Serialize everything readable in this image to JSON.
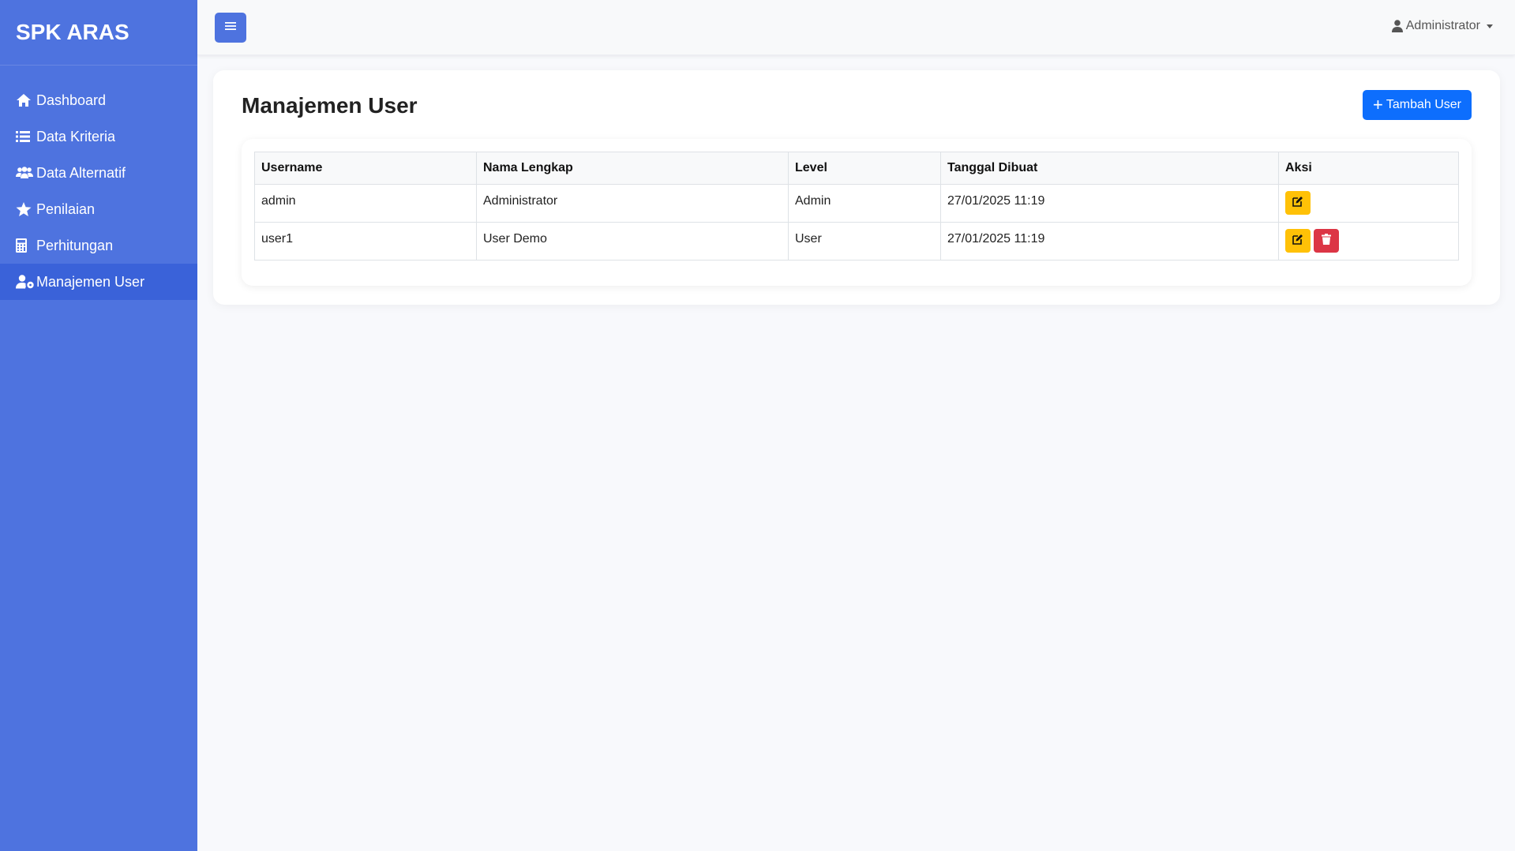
{
  "app": {
    "brand": "SPK ARAS"
  },
  "sidebar": {
    "items": [
      {
        "label": "Dashboard",
        "icon": "home-icon",
        "active": false
      },
      {
        "label": "Data Kriteria",
        "icon": "list-icon",
        "active": false
      },
      {
        "label": "Data Alternatif",
        "icon": "users-icon",
        "active": false
      },
      {
        "label": "Penilaian",
        "icon": "star-icon",
        "active": false
      },
      {
        "label": "Perhitungan",
        "icon": "calculator-icon",
        "active": false
      },
      {
        "label": "Manajemen User",
        "icon": "user-gear-icon",
        "active": true
      }
    ]
  },
  "topbar": {
    "user": "Administrator"
  },
  "main": {
    "title": "Manajemen User",
    "add_button": "Tambah User",
    "table": {
      "headers": [
        "Username",
        "Nama Lengkap",
        "Level",
        "Tanggal Dibuat",
        "Aksi"
      ],
      "rows": [
        {
          "username": "admin",
          "nama": "Administrator",
          "level": "Admin",
          "tanggal": "27/01/2025 11:19",
          "can_delete": false
        },
        {
          "username": "user1",
          "nama": "User Demo",
          "level": "User",
          "tanggal": "27/01/2025 11:19",
          "can_delete": true
        }
      ]
    }
  },
  "colors": {
    "sidebar": "#4e73df",
    "active": "#3a62d9",
    "primary": "#0d6efd",
    "warning": "#ffc107",
    "danger": "#dc3545"
  }
}
